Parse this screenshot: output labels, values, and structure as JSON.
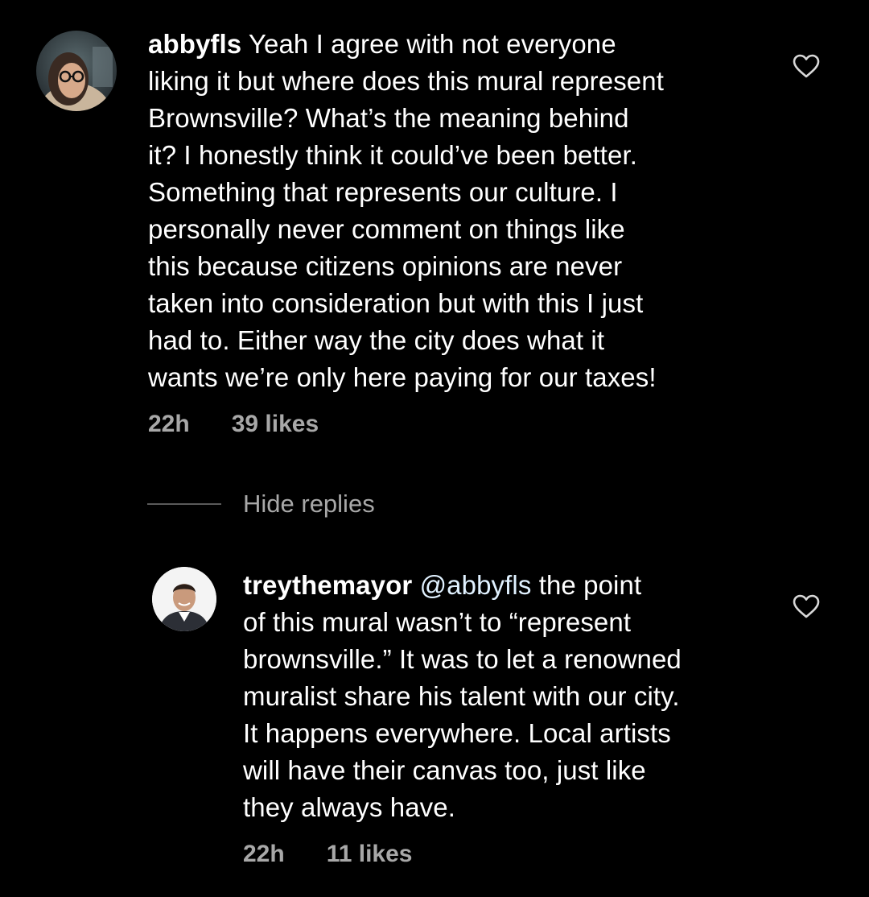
{
  "comments": [
    {
      "username": "abbyfls",
      "text_lines": [
        " Yeah I agree with not everyone",
        "liking it but where does this mural represent",
        "Brownsville? What’s the meaning behind",
        "it? I honestly think it could’ve been better.",
        "Something that represents our culture. I",
        "personally never comment on things like",
        "this because citizens opinions are never",
        "taken into consideration but with this I just",
        "had to. Either way the city does what it",
        "wants we’re only here paying for our taxes!"
      ],
      "time": "22h",
      "likes": "39 likes",
      "avatar_icon": "user-avatar-photo",
      "like_icon": "heart-outline-icon"
    }
  ],
  "hide_replies_label": "Hide replies",
  "reply": {
    "username": "treythemayor",
    "mention": "@abbyfls",
    "first_line_rest": " the point",
    "text_lines": [
      "of this mural wasn’t to “represent",
      "brownsville.” It was to let a renowned",
      "muralist share his talent with our city.",
      "It happens everywhere. Local artists",
      "will have their canvas too, just like",
      "they always have."
    ],
    "time": "22h",
    "likes": "11 likes",
    "avatar_icon": "user-avatar-photo",
    "like_icon": "heart-outline-icon"
  },
  "colors": {
    "background": "#000000",
    "text": "#ffffff",
    "meta": "#a8a8a8",
    "mention": "#e0f1ff"
  }
}
